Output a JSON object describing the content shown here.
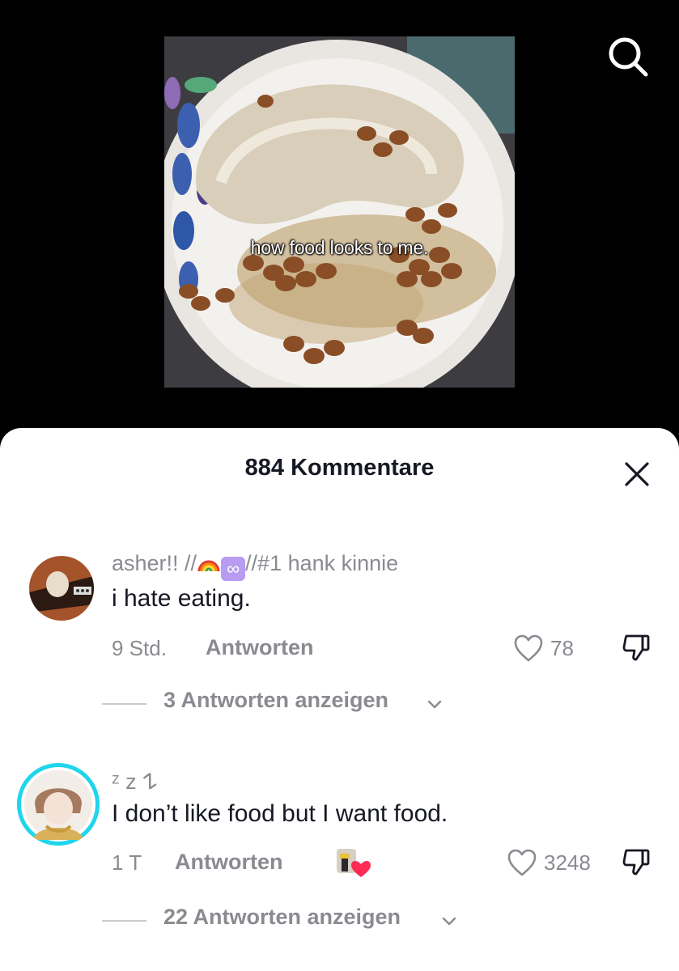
{
  "video": {
    "caption": "how food looks to me."
  },
  "comments_sheet": {
    "title": "884 Kommentare"
  },
  "comments": [
    {
      "username_prefix": "asher!! //",
      "username_suffix": "//#1 hank kinnie",
      "text": "i hate eating.",
      "time": "9 Std.",
      "reply_label": "Antworten",
      "likes": "78",
      "view_replies_label": "3 Antworten anzeigen"
    },
    {
      "username": "ᶻ z 𐰁",
      "text": "I don’t like food but I want food.",
      "time": "1 T",
      "reply_label": "Antworten",
      "likes": "3248",
      "view_replies_label": "22 Antworten anzeigen"
    }
  ],
  "colors": {
    "text_primary": "#161823",
    "text_secondary": "#8a8b91",
    "creator_heart": "#fe2c55",
    "avatar_ring": "#20d5ec"
  },
  "icons": [
    "search-icon",
    "close-icon",
    "heart-icon",
    "dislike-icon",
    "chevron-down-icon",
    "rainbow-emoji",
    "infinity-emoji"
  ]
}
